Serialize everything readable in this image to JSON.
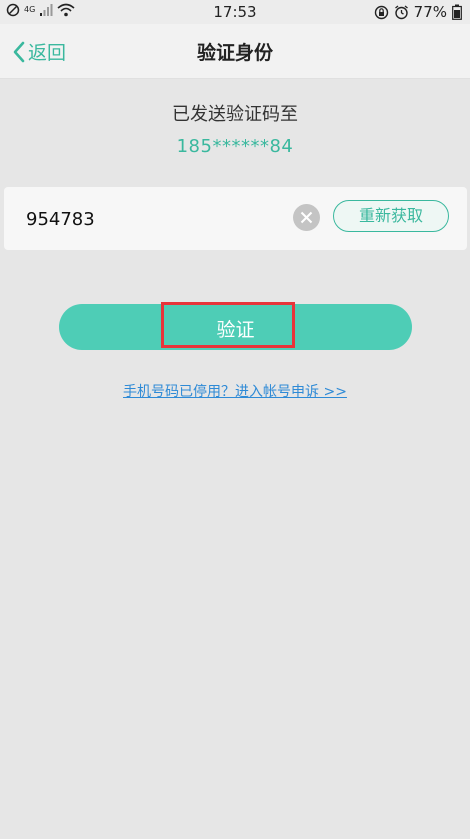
{
  "status_bar": {
    "network": "4G",
    "time": "17:53",
    "battery": "77%",
    "icons": [
      "no-disturb-icon",
      "signal-icon",
      "wifi-icon",
      "lock-rotation-icon",
      "alarm-icon",
      "battery-icon"
    ]
  },
  "header": {
    "back_label": "返回",
    "title": "验证身份"
  },
  "main": {
    "sent_label": "已发送验证码至",
    "phone_masked": "185******84",
    "code_value": "954783",
    "resend_label": "重新获取",
    "verify_label": "验证",
    "appeal_link": "手机号码已停用？进入帐号申诉 >>"
  },
  "colors": {
    "accent": "#3ab89e",
    "button": "#4ecdb6",
    "link": "#2e8ad6",
    "highlight": "#e8343a",
    "background": "#e6e6e6"
  }
}
